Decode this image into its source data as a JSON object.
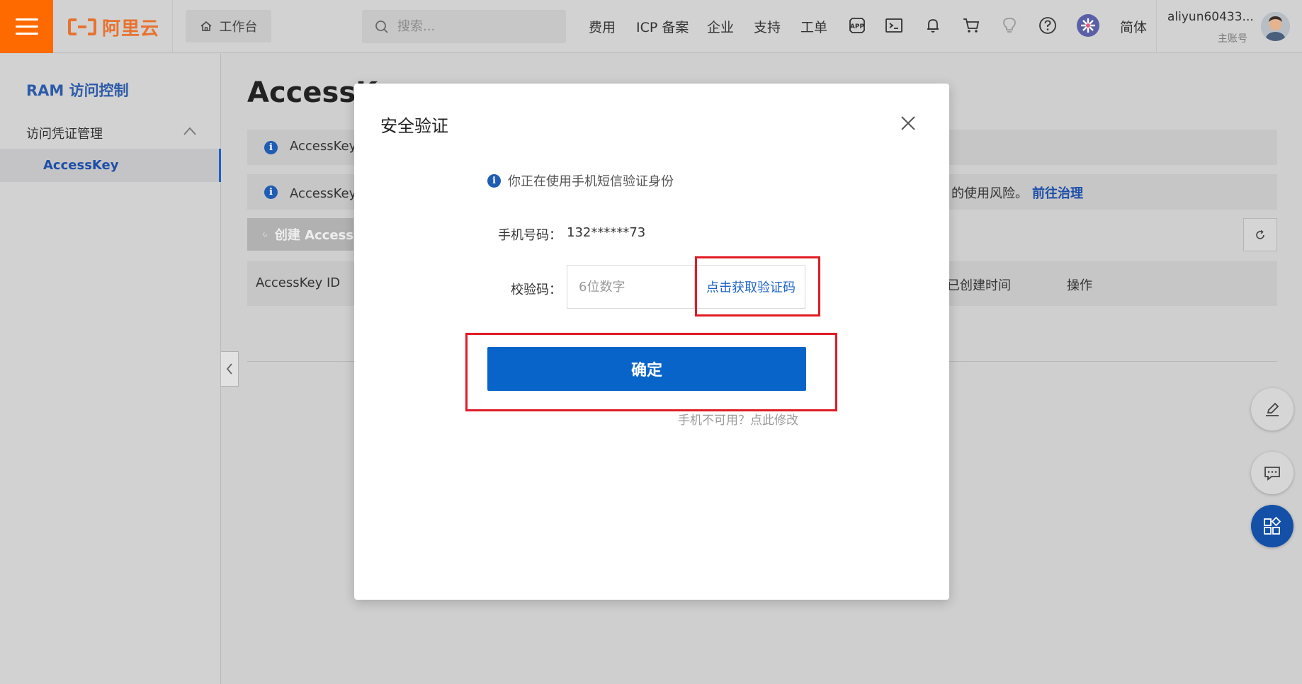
{
  "header": {
    "logo_text": "阿里云",
    "workbench_label": "工作台",
    "search_placeholder": "搜索...",
    "nav": {
      "fees": "费用",
      "icp": "ICP 备案",
      "enterprise": "企业",
      "support": "支持",
      "tickets": "工单",
      "lang": "简体"
    },
    "user": {
      "name": "aliyun60433...",
      "role": "主账号"
    }
  },
  "sidebar": {
    "title": "RAM 访问控制",
    "group": "访问凭证管理",
    "items": [
      {
        "label": "AccessKey"
      }
    ]
  },
  "main": {
    "title": "AccessK",
    "info1": "AccessKey I",
    "info2_left": "AccessKey 石",
    "info2_right": "的使用风险。",
    "info2_link": "前往治理",
    "create_button": "创建 Access",
    "table_headers": {
      "id": "AccessKey ID",
      "created": "已创建时间",
      "action": "操作"
    }
  },
  "modal": {
    "title": "安全验证",
    "info": "你正在使用手机短信验证身份",
    "phone_label": "手机号码：",
    "phone_value": "132******73",
    "code_label": "校验码：",
    "code_placeholder": "6位数字",
    "get_code_button": "点击获取验证码",
    "confirm_button": "确定",
    "phone_unavailable": "手机不可用？点此修改"
  },
  "colors": {
    "brand_orange": "#ff6a00",
    "primary_blue": "#0964c9",
    "highlight_red": "#e01b24"
  }
}
